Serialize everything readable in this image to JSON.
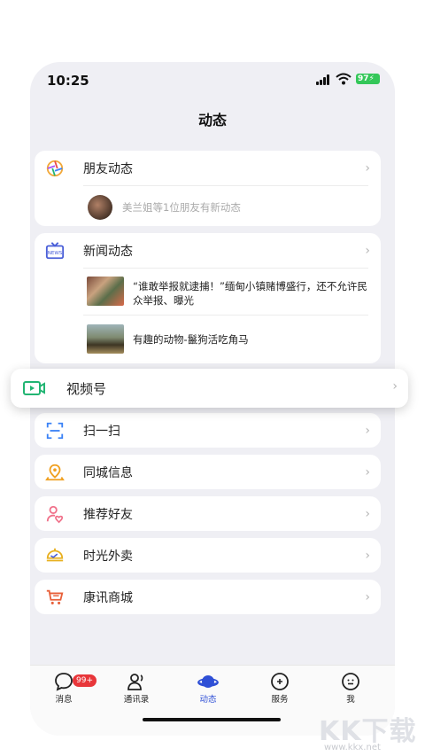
{
  "status_bar": {
    "time": "10:25",
    "battery": "97"
  },
  "page": {
    "title": "动态"
  },
  "moments": {
    "label": "朋友动态",
    "update_text": "美兰姐等1位朋友有新动态"
  },
  "news": {
    "label": "新闻动态",
    "items": [
      {
        "text": "“谁敢举报就逮捕！”缅甸小镇赌博盛行，还不允许民众举报、曝光"
      },
      {
        "text": "有趣的动物-鬣狗活吃角马"
      }
    ]
  },
  "channels": {
    "label": "视频号"
  },
  "menu": [
    {
      "label": "扫一扫",
      "icon": "scan-icon"
    },
    {
      "label": "同城信息",
      "icon": "location-icon"
    },
    {
      "label": "推荐好友",
      "icon": "person-add-icon"
    },
    {
      "label": "时光外卖",
      "icon": "delivery-icon"
    },
    {
      "label": "康讯商城",
      "icon": "shopping-cart-icon"
    }
  ],
  "tabbar": {
    "badge": "99+",
    "tabs": [
      {
        "label": "消息",
        "icon": "chat-bubble-icon"
      },
      {
        "label": "通讯录",
        "icon": "contacts-icon"
      },
      {
        "label": "动态",
        "icon": "planet-icon"
      },
      {
        "label": "服务",
        "icon": "service-icon"
      },
      {
        "label": "我",
        "icon": "profile-icon"
      }
    ]
  },
  "watermark": {
    "logo_text": "KK下载",
    "url": "www.kkx.net"
  },
  "colors": {
    "accent": "#2e4fd6",
    "badge": "#e8363a",
    "battery": "#34c759"
  }
}
